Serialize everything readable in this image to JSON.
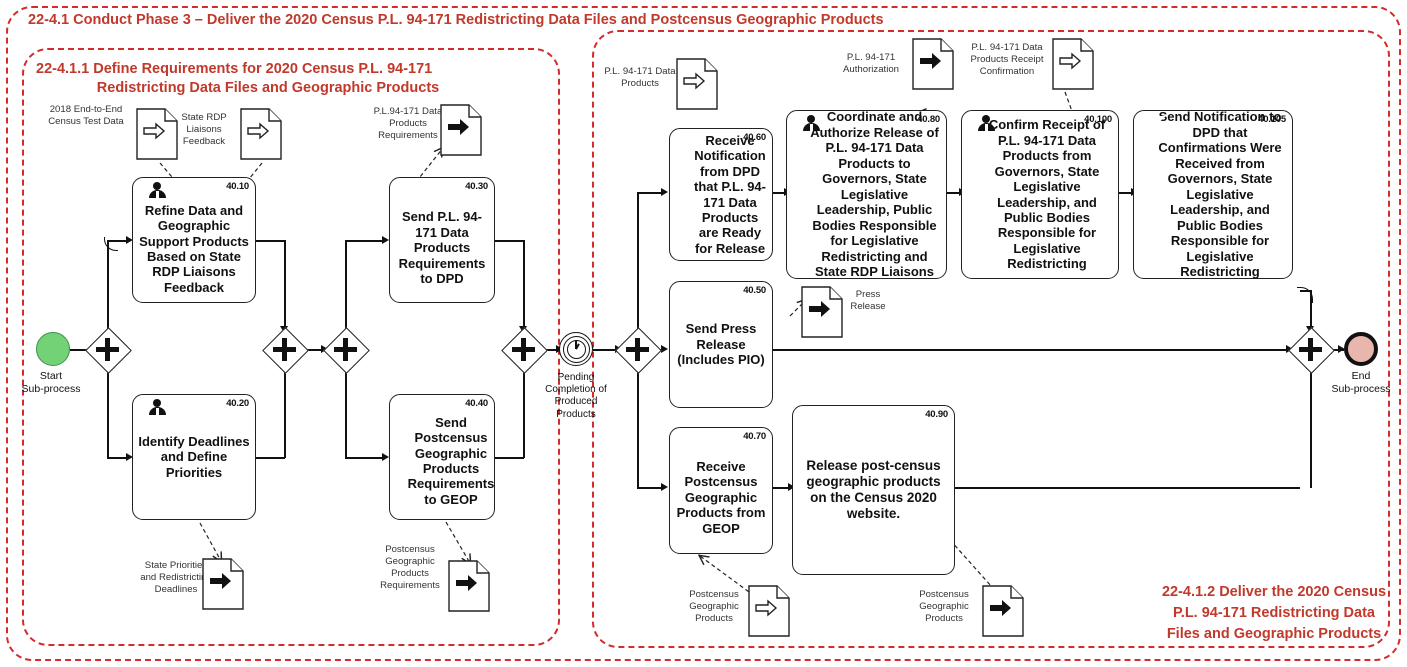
{
  "pools": {
    "outer_title": "22-4.1 Conduct Phase 3 – Deliver the 2020 Census P.L. 94-171 Redistricting Data Files and Postcensus Geographic Products",
    "left_title_line1": "22-4.1.1 Define Requirements for 2020 Census P.L. 94-171",
    "left_title_line2": "Redistricting Data Files and Geographic Products",
    "right_title": "22-4.1.2 Deliver the 2020 Census P.L. 94-171 Redistricting Data Files and Geographic Products"
  },
  "events": {
    "start_label": "Start\nSub-process",
    "start_color": "#74d276",
    "end_label": "End\nSub-process",
    "end_color": "#e8b6ac",
    "timer_label": "Pending Completion of Produced Products"
  },
  "tasks": [
    {
      "id": "40.10",
      "label": "Refine Data and Geographic Support Products Based on State RDP Liaisons Feedback",
      "icon": "user-icon"
    },
    {
      "id": "40.20",
      "label": "Identify Deadlines and Define Priorities",
      "icon": "user-icon"
    },
    {
      "id": "40.30",
      "label": "Send P.L. 94-171 Data Products Requirements to DPD",
      "icon": "envelope-icon"
    },
    {
      "id": "40.40",
      "label": "Send Postcensus Geographic Products Requirements to GEOP",
      "icon": "envelope-icon"
    },
    {
      "id": "40.60",
      "label": "Receive Notification from DPD that P.L. 94-171 Data Products are Ready for Release",
      "icon": "envelope-icon"
    },
    {
      "id": "40.80",
      "label": "Coordinate and Authorize Release of P.L. 94-171 Data Products to Governors, State Legislative Leadership, Public Bodies Responsible for Legislative Redistricting and State RDP Liaisons",
      "icon": "user-icon"
    },
    {
      "id": "40.100",
      "label": "Confirm Receipt of P.L. 94-171 Data Products from Governors, State Legislative Leadership, and  Public Bodies Responsible for Legislative Redistricting",
      "icon": "user-icon"
    },
    {
      "id": "40.105",
      "label": "Send Notification to DPD that Confirmations Were Received from Governors, State Legislative Leadership, and Public Bodies Responsible for Legislative Redistricting",
      "icon": "envelope-icon"
    },
    {
      "id": "40.50",
      "label": "Send Press Release (Includes PIO)",
      "icon": "envelope-icon"
    },
    {
      "id": "40.70",
      "label": "Receive Postcensus Geographic Products  from GEOP",
      "icon": "envelope-icon"
    },
    {
      "id": "40.90",
      "label": "Release post-census geographic products on the Census 2020 website.",
      "icon": "envelope-icon"
    }
  ],
  "data_objects": [
    {
      "key": "test_data",
      "label": "2018 End-to-End Census Test Data",
      "arrow": "hollow"
    },
    {
      "key": "liaison_fb",
      "label": "State RDP Liaisons Feedback",
      "arrow": "hollow"
    },
    {
      "key": "pl_req",
      "label": "P.L.94-171 Data Products Requirements",
      "arrow": "solid"
    },
    {
      "key": "state_prio",
      "label": "State Priorities and Redistricting Deadlines",
      "arrow": "solid"
    },
    {
      "key": "post_req",
      "label": "Postcensus Geographic Products Requirements",
      "arrow": "solid"
    },
    {
      "key": "pl_products",
      "label": "P.L. 94-171 Data Products",
      "arrow": "hollow"
    },
    {
      "key": "pl_auth",
      "label": "P.L. 94-171 Authorization",
      "arrow": "solid"
    },
    {
      "key": "pl_receipt",
      "label": "P.L. 94-171 Data Products Receipt Confirmation",
      "arrow": "hollow"
    },
    {
      "key": "press_release",
      "label": "Press Release",
      "arrow": "solid"
    },
    {
      "key": "post_geo_in",
      "label": "Postcensus Geographic Products",
      "arrow": "hollow"
    },
    {
      "key": "post_geo_out",
      "label": "Postcensus Geographic Products",
      "arrow": "solid"
    }
  ],
  "gateways": [
    {
      "key": "g1",
      "type": "parallel"
    },
    {
      "key": "g2",
      "type": "parallel"
    },
    {
      "key": "g3",
      "type": "parallel"
    },
    {
      "key": "g4",
      "type": "parallel"
    },
    {
      "key": "g5",
      "type": "parallel"
    },
    {
      "key": "g6",
      "type": "parallel"
    }
  ]
}
